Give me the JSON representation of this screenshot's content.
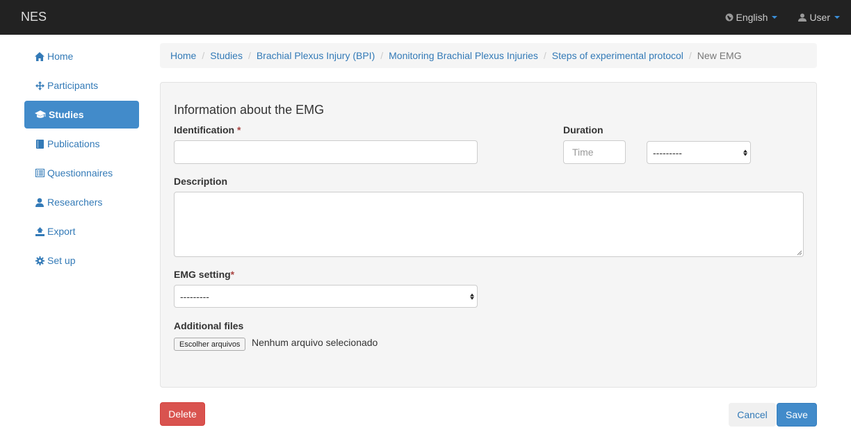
{
  "navbar": {
    "brand": "NES",
    "language_label": "English",
    "user_label": "User"
  },
  "sidebar": {
    "items": [
      {
        "label": "Home",
        "icon": "home-icon"
      },
      {
        "label": "Participants",
        "icon": "move-icon"
      },
      {
        "label": "Studies",
        "icon": "graduation-cap-icon",
        "active": true
      },
      {
        "label": "Publications",
        "icon": "book-icon"
      },
      {
        "label": "Questionnaires",
        "icon": "list-alt-icon"
      },
      {
        "label": "Researchers",
        "icon": "user-icon"
      },
      {
        "label": "Export",
        "icon": "export-icon"
      },
      {
        "label": "Set up",
        "icon": "cog-icon"
      }
    ]
  },
  "breadcrumb": [
    "Home",
    "Studies",
    "Brachial Plexus Injury (BPI)",
    "Monitoring Brachial Plexus Injuries",
    "Steps of experimental protocol",
    "New EMG"
  ],
  "form": {
    "title": "Information about the EMG",
    "identification_label": "Identification",
    "required_mark": "*",
    "identification_value": "",
    "duration_label": "Duration",
    "duration_placeholder": "Time",
    "duration_unit_value": "---------",
    "description_label": "Description",
    "description_value": "",
    "emg_setting_label": "EMG setting",
    "emg_setting_value": "---------",
    "additional_files_label": "Additional files",
    "file_button_label": "Escolher arquivos",
    "file_status": "Nenhum arquivo selecionado"
  },
  "actions": {
    "delete_label": "Delete",
    "cancel_label": "Cancel",
    "save_label": "Save"
  },
  "colors": {
    "navbar_bg": "#222222",
    "link": "#337ab7",
    "primary": "#428bca",
    "danger": "#d9534f",
    "required": "#a94442"
  }
}
